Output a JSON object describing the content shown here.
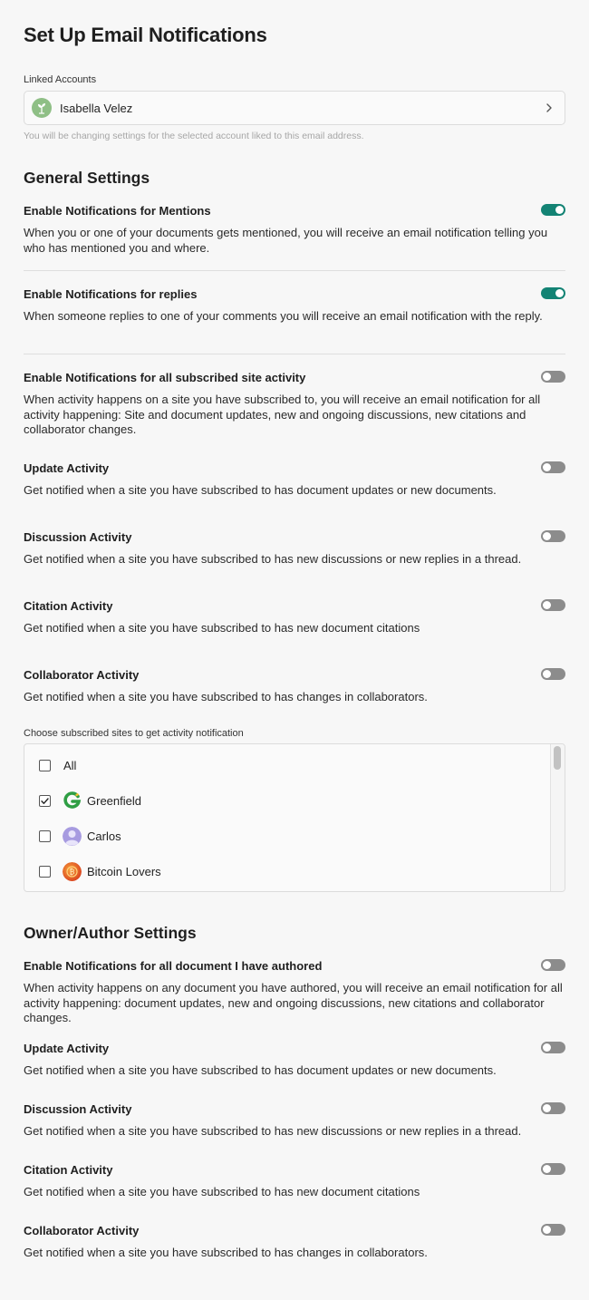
{
  "title": "Set Up Email Notifications",
  "linked_accounts": {
    "label": "Linked Accounts",
    "selected_name": "Isabella Velez",
    "hint": "You will be changing settings for the selected account liked to this email address.",
    "avatar_icon": "sprout-icon",
    "chevron_icon": "chevron-right-icon"
  },
  "general": {
    "heading": "General Settings",
    "mentions": {
      "title": "Enable Notifications for Mentions",
      "desc": "When you or one of your documents gets mentioned, you will receive an email notification telling you who has mentioned you and where.",
      "enabled": true
    },
    "replies": {
      "title": "Enable Notifications for replies",
      "desc": "When someone replies to one of your comments you will receive an email notification with the reply.",
      "enabled": true
    },
    "site_activity": {
      "title": "Enable Notifications for all subscribed site activity",
      "desc": "When activity happens on a site you have subscribed to, you will receive an email notification for all activity happening: Site and document updates, new and ongoing discussions, new citations and collaborator changes.",
      "enabled": false
    },
    "update": {
      "title": "Update Activity",
      "desc": "Get notified when a site you have subscribed to has document updates or new documents.",
      "enabled": false
    },
    "discussion": {
      "title": "Discussion Activity",
      "desc": "Get notified when a site you have subscribed to has new discussions or new replies in a thread.",
      "enabled": false
    },
    "citation": {
      "title": "Citation Activity",
      "desc": "Get notified when a site you have subscribed to has new document citations",
      "enabled": false
    },
    "collaborator": {
      "title": "Collaborator Activity",
      "desc": "Get notified when a site you have subscribed to has changes in collaborators.",
      "enabled": false
    },
    "sites_label": "Choose subscribed sites to get activity notification",
    "sites": [
      {
        "name": "All",
        "checked": false,
        "icon": ""
      },
      {
        "name": "Greenfield",
        "checked": true,
        "icon": "greenfield-logo-icon"
      },
      {
        "name": "Carlos",
        "checked": false,
        "icon": "person-avatar-icon"
      },
      {
        "name": "Bitcoin Lovers",
        "checked": false,
        "icon": "bitcoin-logo-icon"
      }
    ]
  },
  "owner": {
    "heading": "Owner/Author Settings",
    "authored": {
      "title": "Enable Notifications for all document I have authored",
      "desc": "When activity happens on any document you have authored, you will receive an email notification for all activity happening: document updates, new and ongoing discussions, new citations and collaborator changes.",
      "enabled": false
    },
    "update": {
      "title": "Update Activity",
      "desc": "Get notified when a site you have subscribed to has document updates or new documents.",
      "enabled": false
    },
    "discussion": {
      "title": "Discussion Activity",
      "desc": "Get notified when a site you have subscribed to has new discussions or new replies in a thread.",
      "enabled": false
    },
    "citation": {
      "title": "Citation Activity",
      "desc": "Get notified when a site you have subscribed to has new document citations",
      "enabled": false
    },
    "collaborator": {
      "title": "Collaborator Activity",
      "desc": "Get notified when a site you have subscribed to has changes in collaborators.",
      "enabled": false
    }
  },
  "colors": {
    "toggle_on": "#138374",
    "toggle_off": "#8c8c8c",
    "background": "#f7f7f7"
  }
}
